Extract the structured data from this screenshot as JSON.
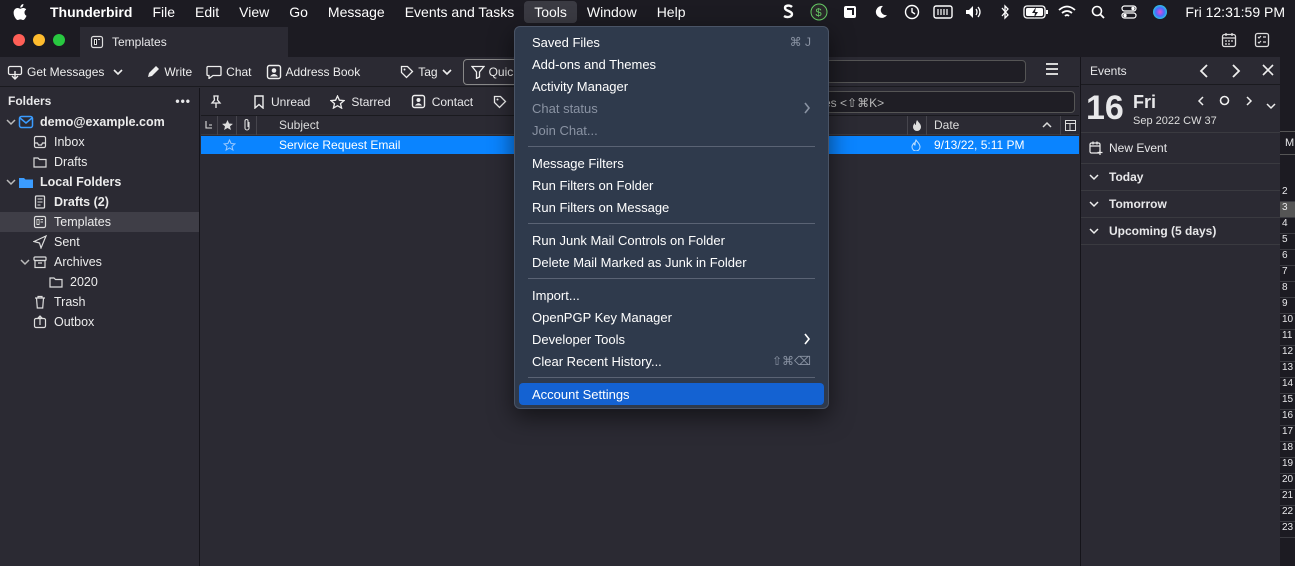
{
  "menubar": {
    "app": "Thunderbird",
    "items": [
      "File",
      "Edit",
      "View",
      "Go",
      "Message",
      "Events and Tasks",
      "Tools",
      "Window",
      "Help"
    ],
    "clock": "Fri  12:31:59 PM"
  },
  "tab": {
    "label": "Templates"
  },
  "toolbar": {
    "get_messages": "Get Messages",
    "write": "Write",
    "chat": "Chat",
    "address_book": "Address Book",
    "tag": "Tag",
    "quick_filter": "Quick"
  },
  "folders": {
    "header": "Folders",
    "more": "•••",
    "items": [
      {
        "label": "demo@example.com",
        "bold": true
      },
      {
        "label": "Inbox"
      },
      {
        "label": "Drafts"
      },
      {
        "label": "Local Folders",
        "bold": true
      },
      {
        "label": "Drafts (2)",
        "bold": true
      },
      {
        "label": "Templates"
      },
      {
        "label": "Sent"
      },
      {
        "label": "Archives"
      },
      {
        "label": "2020"
      },
      {
        "label": "Trash"
      },
      {
        "label": "Outbox"
      }
    ]
  },
  "quickfilter": {
    "unread": "Unread",
    "starred": "Starred",
    "contact": "Contact",
    "search_placeholder": "es <⇧⌘K>"
  },
  "columns": {
    "subject": "Subject",
    "date": "Date"
  },
  "message": {
    "subject": "Service Request Email",
    "date": "9/13/22, 5:11 PM"
  },
  "events": {
    "title": "Events",
    "day_number": "16",
    "day_name": "Fri",
    "month_line": "Sep 2022  CW 37",
    "new_event": "New Event",
    "sections": [
      "Today",
      "Tomorrow",
      "Upcoming (5 days)"
    ]
  },
  "calendar_strip": {
    "header": "M",
    "days": [
      "2",
      "3",
      "4",
      "5",
      "6",
      "7",
      "8",
      "9",
      "10",
      "11",
      "12",
      "13",
      "14",
      "15",
      "16",
      "17",
      "18",
      "19",
      "20",
      "21",
      "22",
      "23"
    ]
  },
  "tools_menu": {
    "groups": [
      [
        {
          "label": "Saved Files",
          "shortcut": "⌘ J"
        },
        {
          "label": "Add-ons and Themes"
        },
        {
          "label": "Activity Manager"
        },
        {
          "label": "Chat status",
          "disabled": true,
          "submenu": true
        },
        {
          "label": "Join Chat...",
          "disabled": true
        }
      ],
      [
        {
          "label": "Message Filters"
        },
        {
          "label": "Run Filters on Folder"
        },
        {
          "label": "Run Filters on Message"
        }
      ],
      [
        {
          "label": "Run Junk Mail Controls on Folder"
        },
        {
          "label": "Delete Mail Marked as Junk in Folder"
        }
      ],
      [
        {
          "label": "Import..."
        },
        {
          "label": "OpenPGP Key Manager"
        },
        {
          "label": "Developer Tools",
          "submenu": true
        },
        {
          "label": "Clear Recent History...",
          "shortcut": "⇧⌘⌫"
        }
      ],
      [
        {
          "label": "Account Settings",
          "highlighted": true
        }
      ]
    ]
  },
  "colors": {
    "selection": "#0a84ff",
    "menu_highlight": "#1462d2"
  }
}
